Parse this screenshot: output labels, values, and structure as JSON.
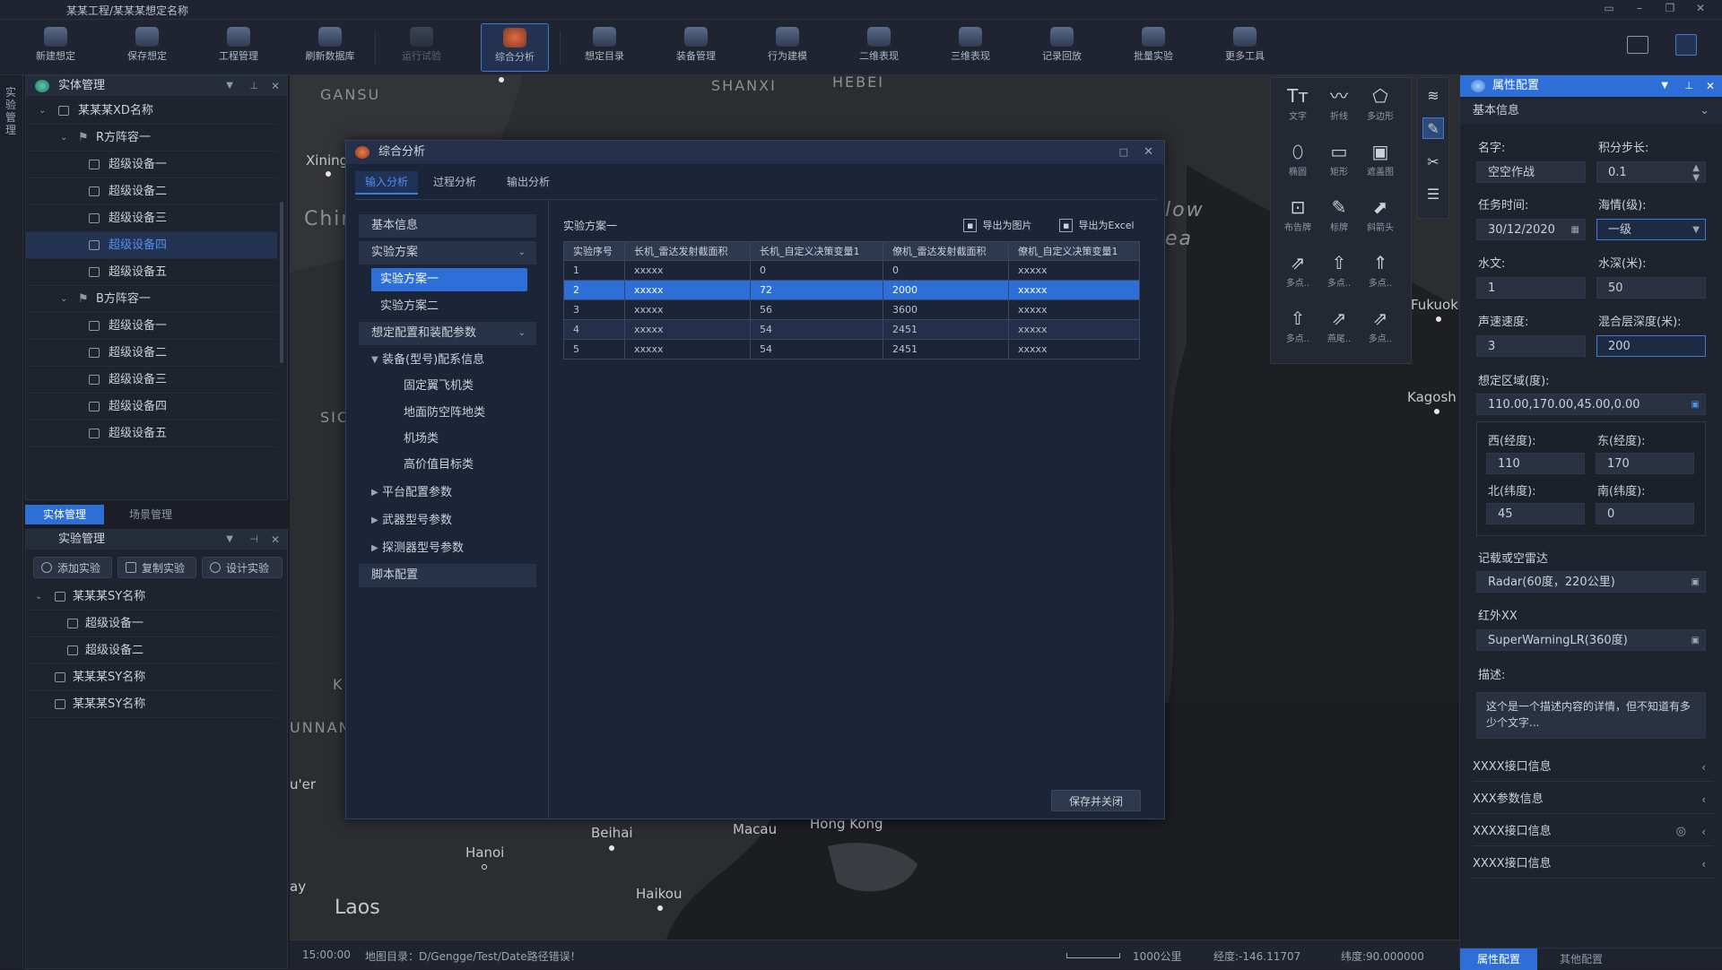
{
  "window": {
    "title": "某某工程/某某某想定名称"
  },
  "toolbar": {
    "items": [
      {
        "label": "新建想定",
        "icon": "new-scenario-icon"
      },
      {
        "label": "保存想定",
        "icon": "save-icon"
      },
      {
        "label": "工程管理",
        "icon": "project-icon"
      },
      {
        "label": "刷新数据库",
        "icon": "database-icon"
      },
      {
        "label": "运行试验",
        "icon": "run-icon"
      },
      {
        "label": "综合分析",
        "icon": "analysis-icon"
      },
      {
        "label": "想定目录",
        "icon": "catalog-icon"
      },
      {
        "label": "装备管理",
        "icon": "equipment-icon"
      },
      {
        "label": "行为建模",
        "icon": "behavior-icon"
      },
      {
        "label": "二维表现",
        "icon": "2d-icon"
      },
      {
        "label": "三维表现",
        "icon": "3d-icon"
      },
      {
        "label": "记录回放",
        "icon": "replay-icon"
      },
      {
        "label": "批量实验",
        "icon": "batch-icon"
      },
      {
        "label": "更多工具",
        "icon": "more-tools-icon"
      }
    ]
  },
  "left_strip": {
    "label": "实验管理"
  },
  "entity_panel": {
    "title": "实体管理",
    "root": "某某某XD名称",
    "groups": [
      {
        "name": "R方阵容一",
        "items": [
          "超级设备一",
          "超级设备二",
          "超级设备三",
          "超级设备四",
          "超级设备五"
        ]
      },
      {
        "name": "B方阵容一",
        "items": [
          "超级设备一",
          "超级设备二",
          "超级设备三",
          "超级设备四",
          "超级设备五"
        ]
      }
    ],
    "tabs": [
      "实体管理",
      "场景管理"
    ]
  },
  "experiment_panel": {
    "title": "实验管理",
    "buttons": [
      "添加实验",
      "复制实验",
      "设计实验"
    ],
    "tree": [
      {
        "name": "某某某SY名称",
        "children": [
          "超级设备一",
          "超级设备二"
        ]
      },
      {
        "name": "某某某SY名称",
        "children": []
      },
      {
        "name": "某某某SY名称",
        "children": []
      }
    ]
  },
  "map": {
    "regions": [
      "GANSU",
      "SHANXI",
      "HEBEI",
      "SIC",
      "UNNAN",
      "K",
      "Chin",
      "low",
      "ea"
    ],
    "cities": [
      "Xining",
      "Fukuok",
      "Kagosh",
      "Beihai",
      "Macau",
      "Hong Kong",
      "Hanoi",
      "Haikou",
      "Laos",
      "u'er",
      "ay"
    ]
  },
  "status": {
    "time": "15:00:00",
    "message": "地图目录：D/Gengge/Test/Date路径错误！",
    "scale": "1000公里",
    "longitude": "经度:-146.11707",
    "latitude": "纬度:90.000000"
  },
  "dialog": {
    "title": "综合分析",
    "tabs": [
      "输入分析",
      "过程分析",
      "输出分析"
    ],
    "nav": {
      "basic": "基本信息",
      "plan_group": "实验方案",
      "plans": [
        "实验方案一",
        "实验方案二"
      ],
      "config_group": "想定配置和装配参数",
      "equip_group": "装备(型号)配系信息",
      "equip_items": [
        "固定翼飞机类",
        "地面防空阵地类",
        "机场类",
        "高价值目标类"
      ],
      "collapsed": [
        "平台配置参数",
        "武器型号参数",
        "探测器型号参数"
      ],
      "script": "脚本配置"
    },
    "content_title": "实验方案一",
    "export_image": "导出为图片",
    "export_excel": "导出为Excel",
    "table": {
      "headers": [
        "实验序号",
        "长机_雷达发射截面积",
        "长机_自定义决策变量1",
        "僚机_雷达发射截面积",
        "僚机_自定义决策变量1"
      ],
      "rows": [
        [
          "1",
          "xxxxx",
          "0",
          "0",
          "xxxxx"
        ],
        [
          "2",
          "xxxxx",
          "72",
          "2000",
          "xxxxx"
        ],
        [
          "3",
          "xxxxx",
          "56",
          "3600",
          "xxxxx"
        ],
        [
          "4",
          "xxxxx",
          "54",
          "2451",
          "xxxxx"
        ],
        [
          "5",
          "xxxxx",
          "54",
          "2451",
          "xxxxx"
        ]
      ],
      "selected_row": 1
    },
    "save_button": "保存并关闭"
  },
  "draw_tools": [
    {
      "label": "文字",
      "glyph": "Tт"
    },
    {
      "label": "折线",
      "glyph": "〰"
    },
    {
      "label": "多边形",
      "glyph": "⬠"
    },
    {
      "label": "椭圆",
      "glyph": "⬯"
    },
    {
      "label": "矩形",
      "glyph": "▭"
    },
    {
      "label": "遮盖图",
      "glyph": "▣"
    },
    {
      "label": "布告牌",
      "glyph": "⊡"
    },
    {
      "label": "标牌",
      "glyph": "✎"
    },
    {
      "label": "斜箭头",
      "glyph": "⬈"
    },
    {
      "label": "多点..",
      "glyph": "⇗"
    },
    {
      "label": "多点..",
      "glyph": "⇧"
    },
    {
      "label": "多点..",
      "glyph": "⇑"
    },
    {
      "label": "多点..",
      "glyph": "⇧"
    },
    {
      "label": "燕尾..",
      "glyph": "⇗"
    },
    {
      "label": "多点..",
      "glyph": "⇗"
    }
  ],
  "props": {
    "title": "属性配置",
    "section": "基本信息",
    "name_label": "名字:",
    "name_value": "空空作战",
    "step_label": "积分步长:",
    "step_value": "0.1",
    "time_label": "任务时间:",
    "time_value": "30/12/2020",
    "sea_label": "海情(级):",
    "sea_value": "一级",
    "hydro_label": "水文:",
    "hydro_value": "1",
    "depth_label": "水深(米):",
    "depth_value": "50",
    "sound_label": "声速速度:",
    "sound_value": "3",
    "mix_label": "混合层深度(米):",
    "mix_value": "200",
    "region_label": "想定区域(度):",
    "region_value": "110.00,170.00,45.00,0.00",
    "west_label": "西(经度):",
    "west_value": "110",
    "east_label": "东(经度):",
    "east_value": "170",
    "north_label": "北(纬度):",
    "north_value": "45",
    "south_label": "南(纬度):",
    "south_value": "0",
    "radar_label": "记载或空雷达",
    "radar_value": "Radar(60度，220公里)",
    "ir_label": "红外XX",
    "ir_value": "SuperWarningLR(360度)",
    "desc_label": "描述:",
    "desc_value": "这个是一个描述内容的详情，但不知道有多少个文字...",
    "sections": [
      "XXXX接口信息",
      "XXX参数信息",
      "XXXX接口信息",
      "XXXX接口信息"
    ],
    "tabs": [
      "属性配置",
      "其他配置"
    ]
  }
}
